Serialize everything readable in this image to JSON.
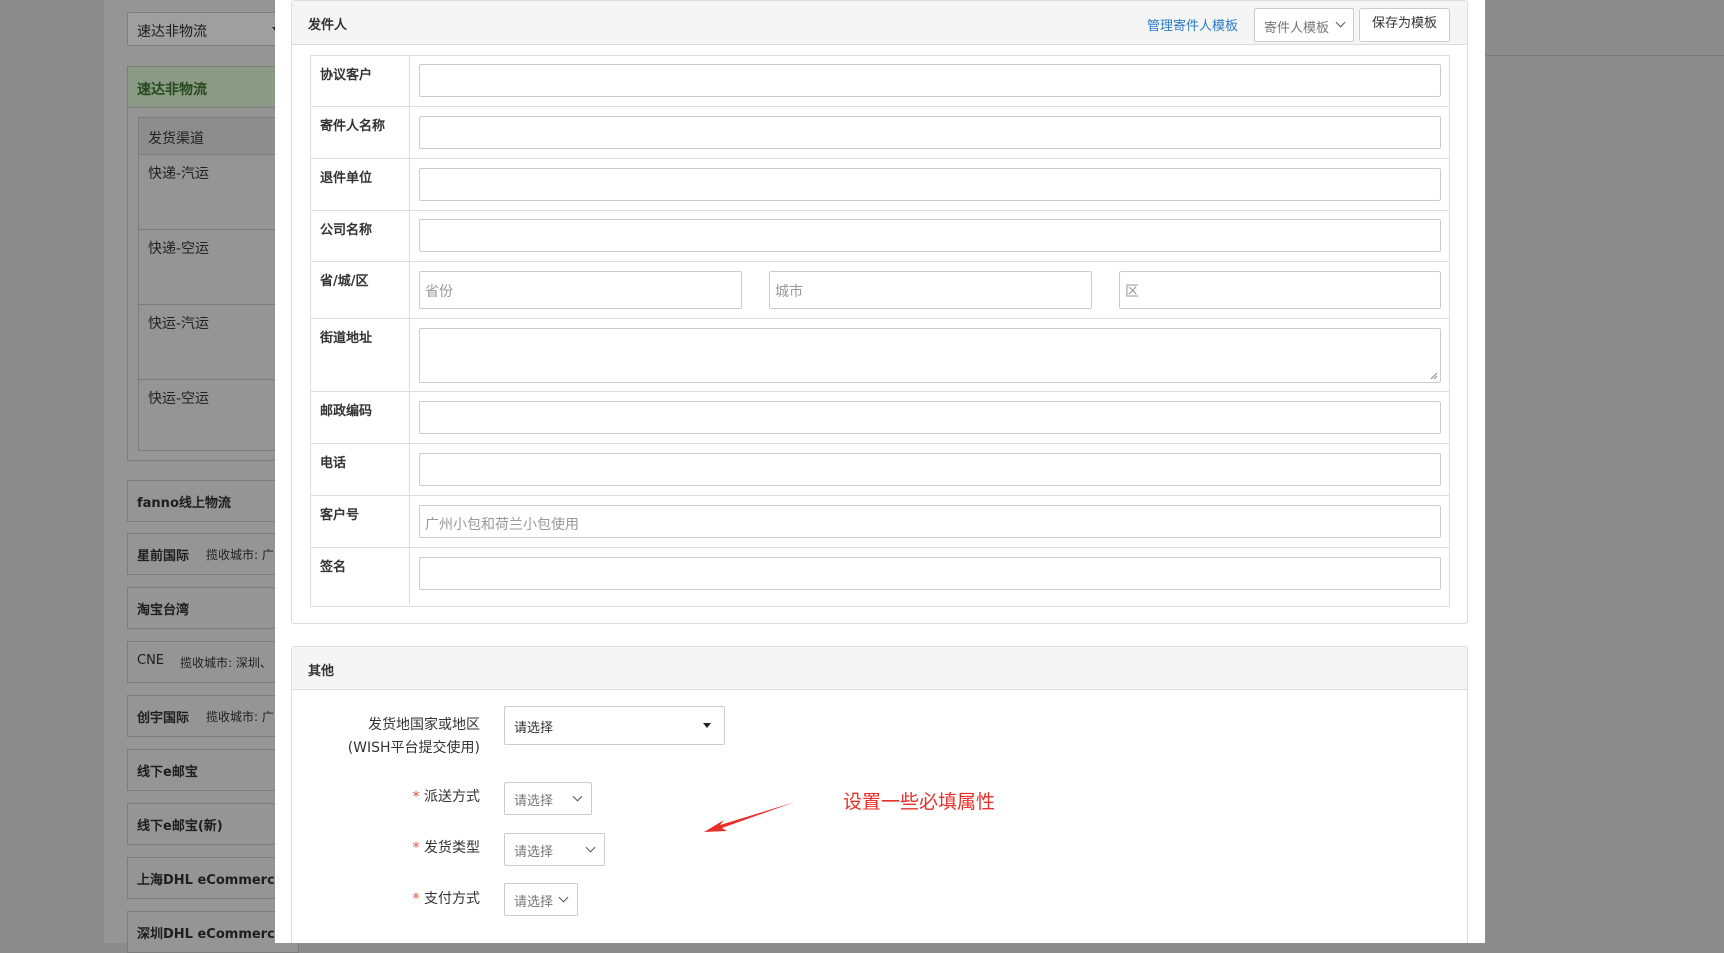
{
  "background": {
    "top_select": "速达非物流",
    "panel_title": "速达非物流",
    "subtable_header": "发货渠道",
    "subtable_rows": [
      "快递-汽运",
      "快递-空运",
      "快运-汽运",
      "快运-空运"
    ],
    "cards": [
      {
        "title": "fanno线上物流",
        "sub": ""
      },
      {
        "title": "星前国际",
        "sub": "揽收城市: 广"
      },
      {
        "title": "淘宝台湾",
        "sub": ""
      },
      {
        "title": "CNE",
        "sub": "揽收城市: 深圳、"
      },
      {
        "title": "创宇国际",
        "sub": "揽收城市: 广"
      },
      {
        "title": "线下e邮宝",
        "sub": ""
      },
      {
        "title": "线下e邮宝(新)",
        "sub": ""
      },
      {
        "title": "上海DHL eCommerce",
        "sub": ""
      },
      {
        "title": "深圳DHL eCommerce",
        "sub": ""
      }
    ]
  },
  "sender": {
    "title": "发件人",
    "manage_link": "管理寄件人模板",
    "template_select": "寄件人模板",
    "save_template": "保存为模板",
    "fields": {
      "agreement_customer": "协议客户",
      "sender_name": "寄件人名称",
      "return_unit": "退件单位",
      "company_name": "公司名称",
      "region": "省/城/区",
      "street": "街道地址",
      "postcode": "邮政编码",
      "phone": "电话",
      "customer_no": "客户号",
      "signature": "签名"
    },
    "placeholders": {
      "province": "省份",
      "city": "城市",
      "district": "区",
      "customer_no": "广州小包和荷兰小包使用"
    }
  },
  "other": {
    "title": "其他",
    "origin_country_label_1": "发货地国家或地区",
    "origin_country_label_2": "(WISH平台提交使用)",
    "origin_country_value": "请选择",
    "required_mark": "*",
    "delivery_method_label": "派送方式",
    "delivery_method_value": "请选择",
    "shipping_type_label": "发货类型",
    "shipping_type_value": "请选择",
    "payment_method_label": "支付方式",
    "payment_method_value": "请选择"
  },
  "annotation": {
    "text": "设置一些必填属性",
    "color": "#e8302a"
  }
}
